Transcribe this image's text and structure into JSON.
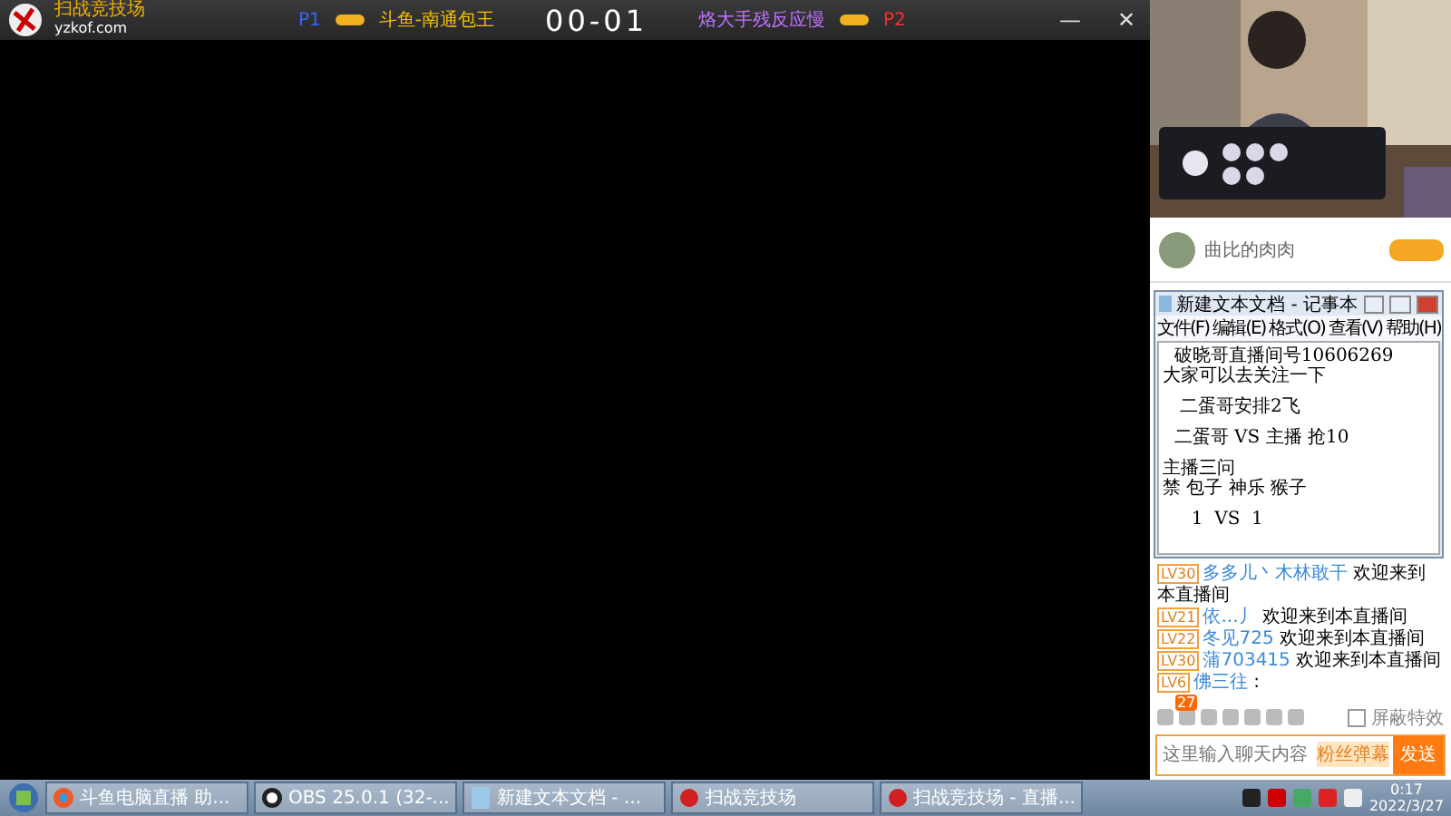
{
  "game": {
    "logo_title": "扫战竞技场",
    "logo_url": "yzkof.com",
    "p1_tag": "P1",
    "p1_name": "斗鱼-南通包王",
    "score": "00-01",
    "p2_name": "烙大手残反应慢",
    "p2_tag": "P2",
    "minimize": "—",
    "close": "✕"
  },
  "side": {
    "anchor_name": "曲比的肉肉",
    "notepad": {
      "title": "新建文本文档 - 记事本",
      "menu": [
        "文件(F)",
        "编辑(E)",
        "格式(O)",
        "查看(V)",
        "帮助(H)"
      ],
      "paragraphs": [
        [
          "  破晓哥直播间号10606269",
          "大家可以去关注一下"
        ],
        [
          "   二蛋哥安排2飞"
        ],
        [
          "  二蛋哥 VS 主播 抢10"
        ],
        [
          "主播三问",
          "禁 包子 神乐 猴子"
        ],
        [
          "     1  VS  1"
        ]
      ]
    },
    "chat": [
      {
        "level": "LV30",
        "user": "多多儿丶木林敢干",
        "message": "欢迎来到本直播间"
      },
      {
        "level": "LV21",
        "user": "依...丿",
        "message": "欢迎来到本直播间"
      },
      {
        "level": "LV22",
        "user": "冬见725",
        "message": "欢迎来到本直播间"
      },
      {
        "level": "LV30",
        "user": "蒲703415",
        "message": "欢迎来到本直播间"
      },
      {
        "level": "LV6",
        "user": "佛三往",
        "message": ":"
      }
    ],
    "gift_badge": "27",
    "block_effects": {
      "label": "屏蔽特效",
      "checked": false
    },
    "input": {
      "placeholder": "这里输入聊天内容"
    },
    "fan_chip": "粉丝弹幕",
    "send": "发送"
  },
  "taskbar": {
    "items": [
      {
        "label": "斗鱼电脑直播 助...",
        "kind": "browser"
      },
      {
        "label": "OBS 25.0.1 (32-...",
        "kind": "obs"
      },
      {
        "label": "新建文本文档 - ...",
        "kind": "notepad"
      },
      {
        "label": "扫战竞技场",
        "kind": "game"
      },
      {
        "label": "扫战竞技场 - 直播...",
        "kind": "game"
      }
    ],
    "time": "0:17",
    "date": "2022/3/27"
  }
}
